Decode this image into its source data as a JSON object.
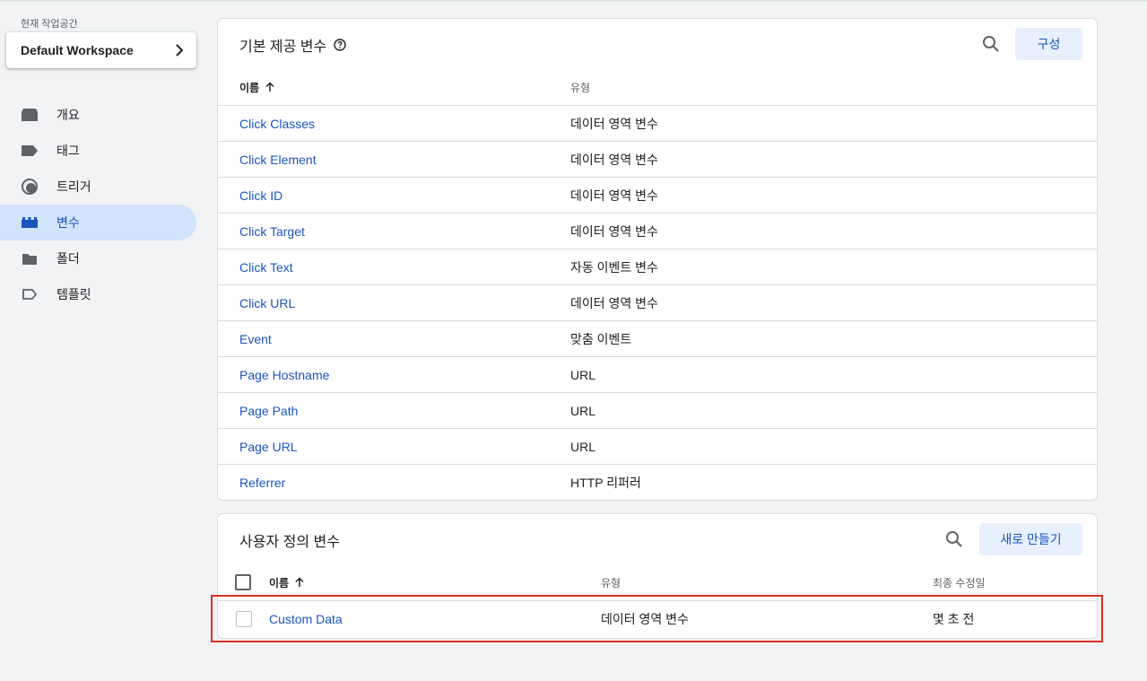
{
  "workspace": {
    "label": "현재 작업공간",
    "name": "Default Workspace"
  },
  "nav": [
    {
      "label": "개요",
      "icon": "overview-icon"
    },
    {
      "label": "태그",
      "icon": "tag-icon"
    },
    {
      "label": "트리거",
      "icon": "trigger-icon"
    },
    {
      "label": "변수",
      "icon": "variables-icon",
      "active": true
    },
    {
      "label": "폴더",
      "icon": "folder-icon"
    },
    {
      "label": "템플릿",
      "icon": "template-icon"
    }
  ],
  "builtin": {
    "title": "기본 제공 변수",
    "configure_label": "구성",
    "col_name": "이름",
    "col_type": "유형",
    "rows": [
      {
        "name": "Click Classes",
        "type": "데이터 영역 변수"
      },
      {
        "name": "Click Element",
        "type": "데이터 영역 변수"
      },
      {
        "name": "Click ID",
        "type": "데이터 영역 변수"
      },
      {
        "name": "Click Target",
        "type": "데이터 영역 변수"
      },
      {
        "name": "Click Text",
        "type": "자동 이벤트 변수"
      },
      {
        "name": "Click URL",
        "type": "데이터 영역 변수"
      },
      {
        "name": "Event",
        "type": "맞춤 이벤트"
      },
      {
        "name": "Page Hostname",
        "type": "URL"
      },
      {
        "name": "Page Path",
        "type": "URL"
      },
      {
        "name": "Page URL",
        "type": "URL"
      },
      {
        "name": "Referrer",
        "type": "HTTP 리퍼러"
      }
    ]
  },
  "custom": {
    "title": "사용자 정의 변수",
    "new_label": "새로 만들기",
    "col_name": "이름",
    "col_type": "유형",
    "col_modified": "최종 수정일",
    "rows": [
      {
        "name": "Custom Data",
        "type": "데이터 영역 변수",
        "modified": "몇 초 전"
      }
    ]
  },
  "colors": {
    "accent": "#1a55c0",
    "highlight": "#d93025",
    "active_bg": "#d2e3fc"
  }
}
